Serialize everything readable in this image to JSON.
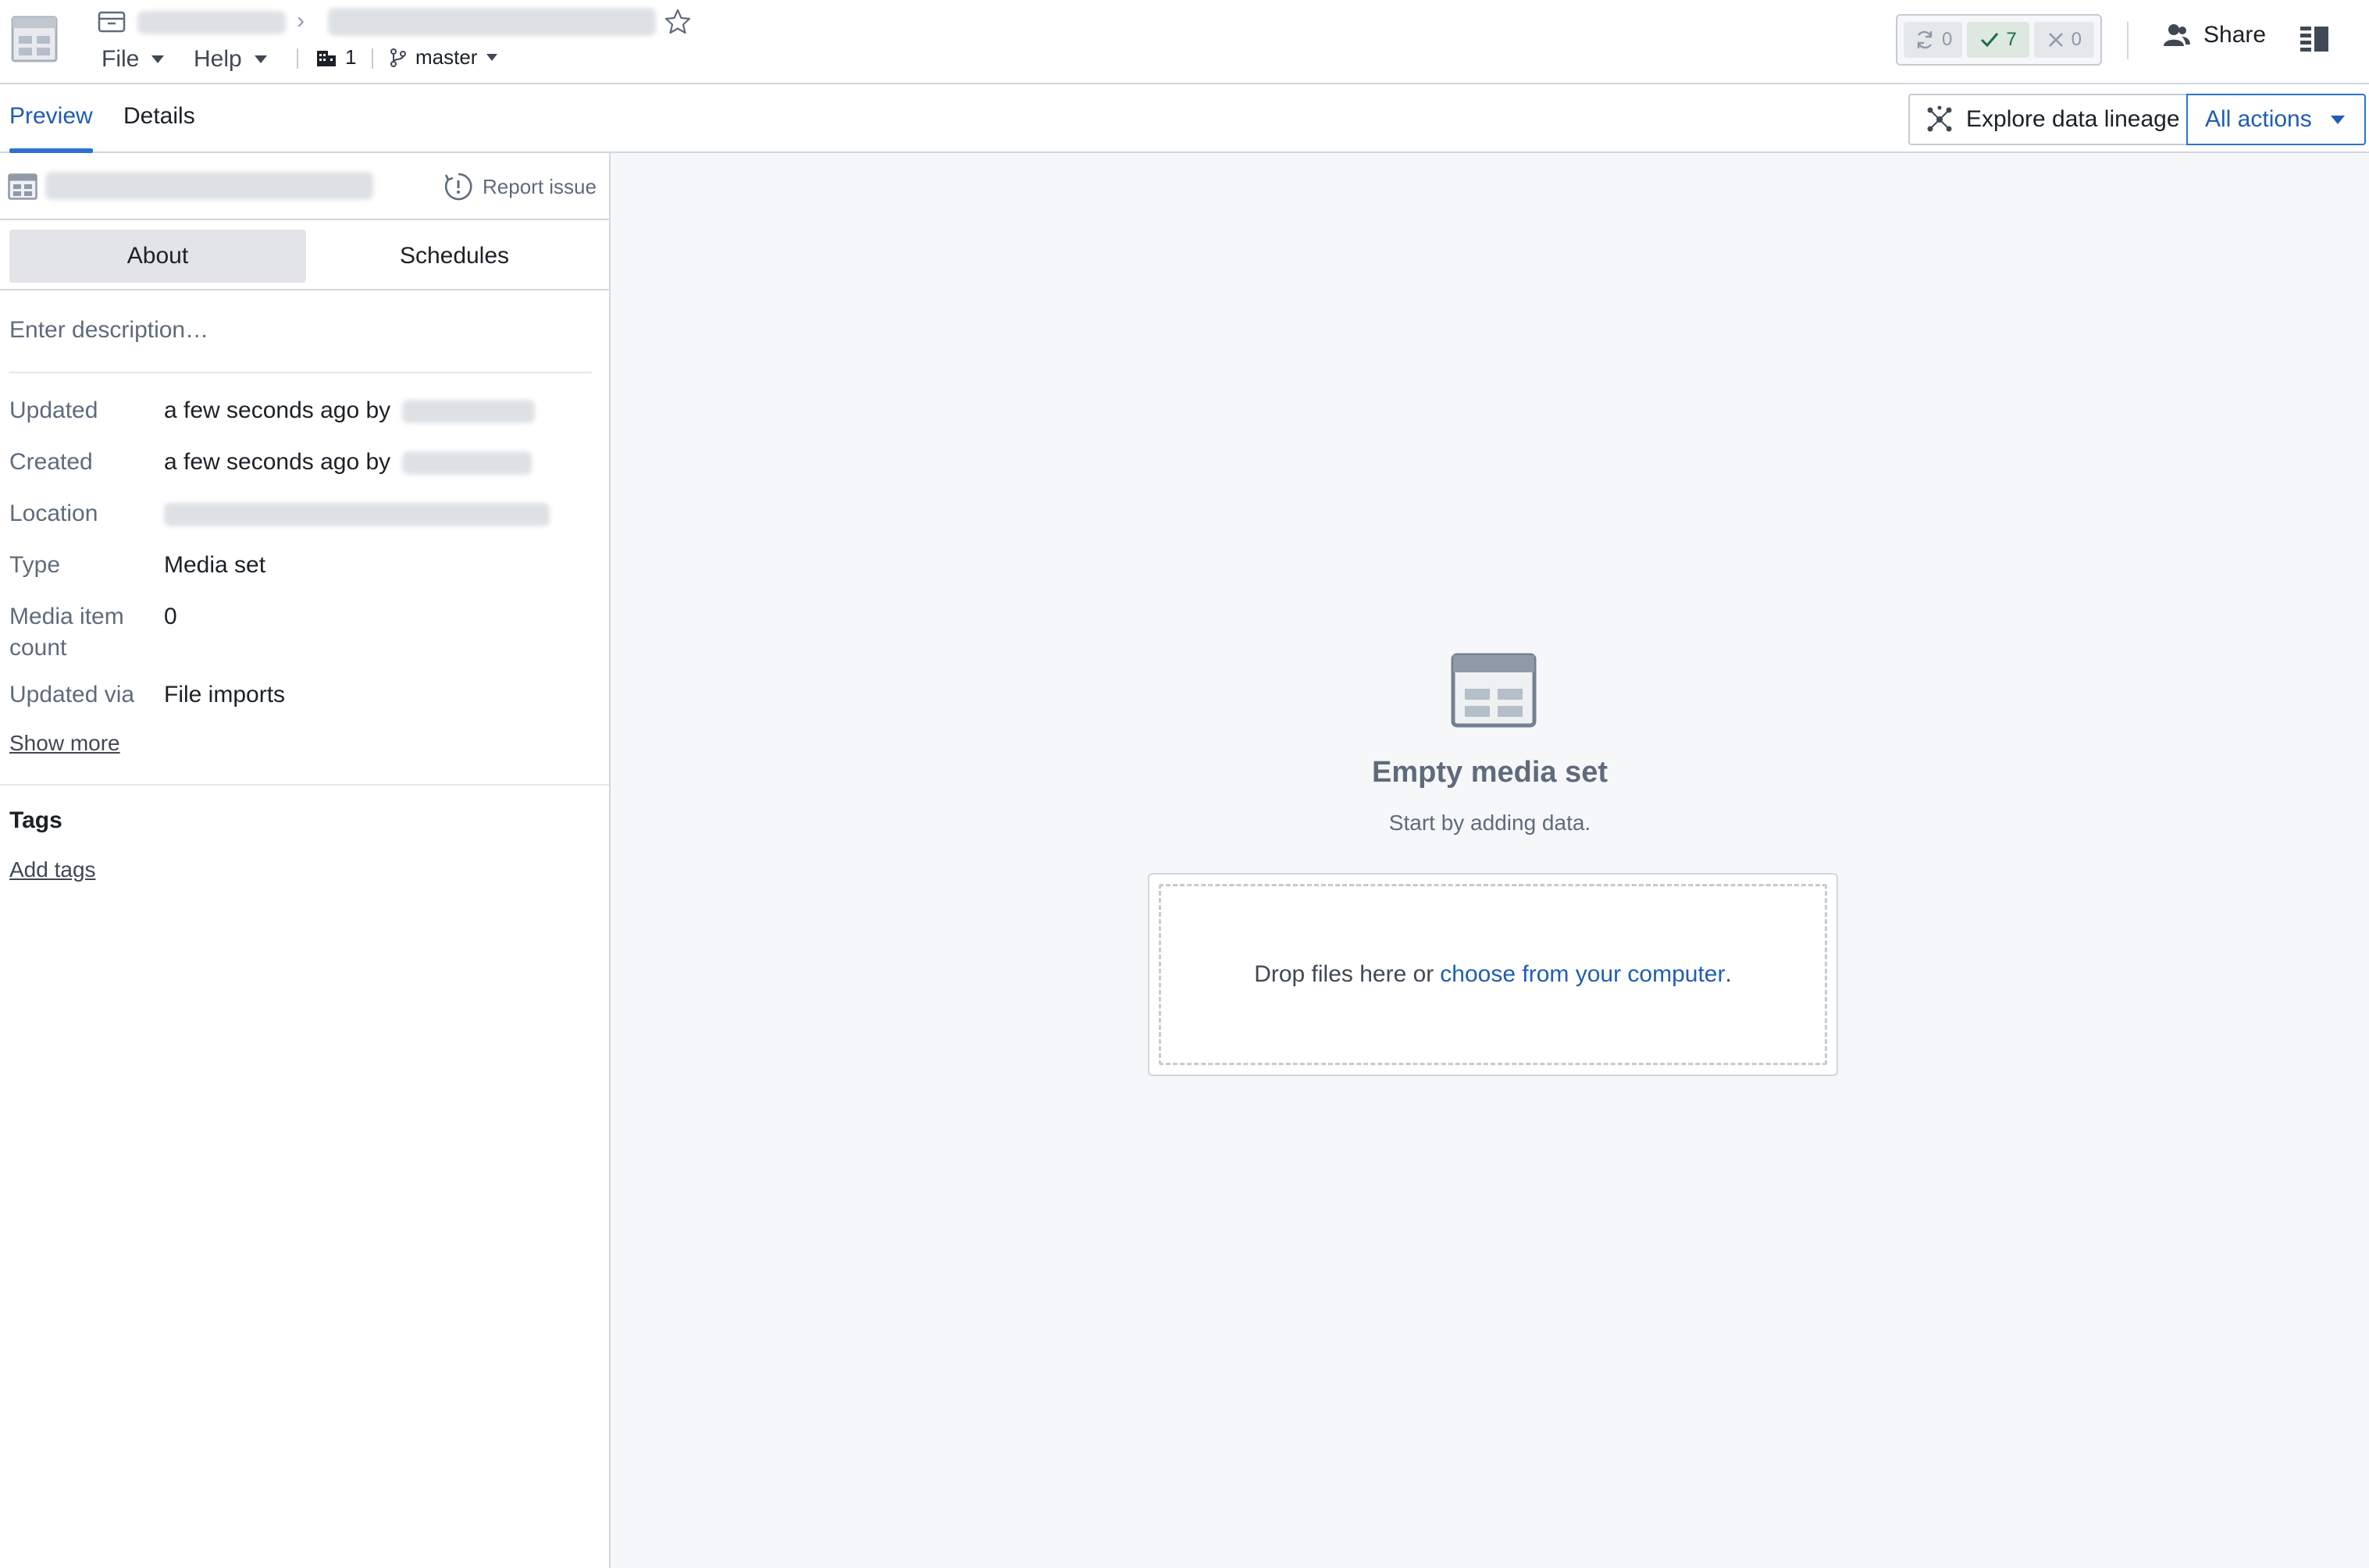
{
  "header": {
    "menu": {
      "file_label": "File",
      "help_label": "Help"
    },
    "project_count": "1",
    "branch": "master",
    "status": {
      "running": "0",
      "succeeded": "7",
      "failed": "0"
    },
    "share_label": "Share"
  },
  "tabs": {
    "preview": "Preview",
    "details": "Details"
  },
  "toolbar": {
    "lineage_label": "Explore data lineage",
    "actions_label": "All actions"
  },
  "sidebar": {
    "report_issue": "Report issue",
    "segments": {
      "about": "About",
      "schedules": "Schedules"
    },
    "description_placeholder": "Enter description…",
    "properties": {
      "updated": {
        "label": "Updated",
        "value": "a few seconds ago by"
      },
      "created": {
        "label": "Created",
        "value": "a few seconds ago by"
      },
      "location": {
        "label": "Location"
      },
      "type": {
        "label": "Type",
        "value": "Media set"
      },
      "media_item_count": {
        "label": "Media item count",
        "value": "0"
      },
      "updated_via": {
        "label": "Updated via",
        "value": "File imports"
      }
    },
    "show_more": "Show more",
    "tags_title": "Tags",
    "add_tags": "Add tags"
  },
  "main": {
    "empty_title": "Empty media set",
    "empty_subtitle": "Start by adding data.",
    "drop_text": "Drop files here or",
    "drop_link": "choose from your computer",
    "drop_suffix": "."
  },
  "colors": {
    "accent": "#2d72d2",
    "link": "#215db0",
    "success": "#1c6e42",
    "muted_text": "#5f6b7c",
    "main_bg": "#f6f7f9"
  },
  "icons": {
    "app": "media-set-icon",
    "folder": "folder-icon",
    "star": "star-icon",
    "project": "building-icon",
    "branch": "git-branch-icon",
    "running": "refresh-icon",
    "success": "check-icon",
    "failed": "x-icon",
    "share": "people-icon",
    "panel": "panel-toggle-icon",
    "lineage": "lineage-icon",
    "report": "warning-circle-icon"
  }
}
